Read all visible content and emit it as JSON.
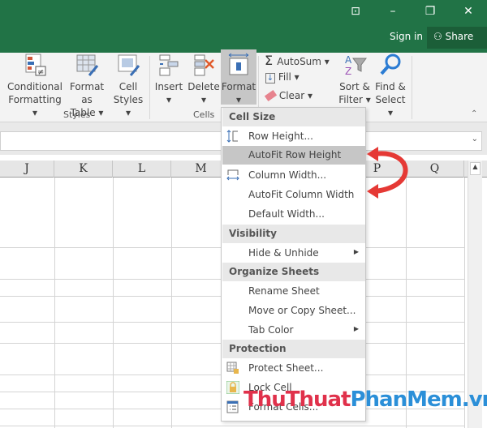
{
  "window": {
    "restore_ribbon_icon": "ribbon-display-icon",
    "minimize": "–",
    "maximize": "❐",
    "close": "✕",
    "sign_in": "Sign in",
    "share": "Share"
  },
  "ribbon": {
    "styles": {
      "label": "Styles",
      "conditional_formatting": [
        "Conditional",
        "Formatting ▾"
      ],
      "format_as_table": [
        "Format as",
        "Table ▾"
      ],
      "cell_styles": [
        "Cell",
        "Styles ▾"
      ]
    },
    "cells": {
      "label": "Cells",
      "insert": "Insert",
      "delete": "Delete",
      "format": "Format",
      "caret": "▾"
    },
    "editing": {
      "autosum": "AutoSum ▾",
      "fill": "Fill ▾",
      "clear": "Clear ▾",
      "sort_filter": [
        "Sort &",
        "Filter ▾"
      ],
      "find_select": [
        "Find &",
        "Select ▾"
      ]
    },
    "collapse": "⌃"
  },
  "columns": [
    "J",
    "K",
    "L",
    "M",
    "P",
    "Q"
  ],
  "menu": {
    "sections": [
      "Cell Size",
      "Visibility",
      "Organize Sheets",
      "Protection"
    ],
    "items": [
      "Row Height...",
      "AutoFit Row Height",
      "Column Width...",
      "AutoFit Column Width",
      "Default Width...",
      "Hide & Unhide",
      "Rename Sheet",
      "Move or Copy Sheet...",
      "Tab Color",
      "Protect Sheet...",
      "Lock Cell",
      "Format Cells..."
    ],
    "highlighted": "AutoFit Row Height"
  },
  "watermark": {
    "part1": "ThuThuat",
    "part2": "PhanMem",
    ".vn": ".vn",
    "color1": "#e0314b",
    "color2": "#2b8fd8"
  },
  "colors": {
    "excel_green": "#217346",
    "arrow_red": "#e53935"
  }
}
